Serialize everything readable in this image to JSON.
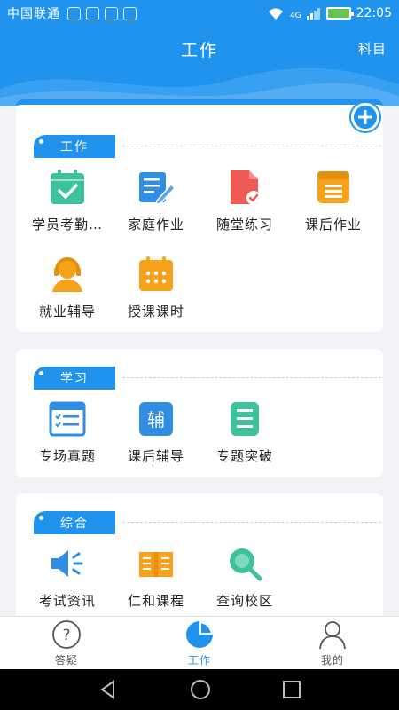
{
  "status": {
    "carrier": "中国联通",
    "network": "4G",
    "time": "22:05"
  },
  "header": {
    "title": "工作",
    "action": "科目"
  },
  "sections": [
    {
      "title": "工作",
      "items": [
        {
          "label": "学员考勤…",
          "icon": "attendance-calendar-icon",
          "color": "#3dc29b"
        },
        {
          "label": "家庭作业",
          "icon": "homework-edit-icon",
          "color": "#2f8de4"
        },
        {
          "label": "随堂练习",
          "icon": "practice-doc-icon",
          "color": "#ef5a57"
        },
        {
          "label": "课后作业",
          "icon": "after-class-list-icon",
          "color": "#f7a21b"
        },
        {
          "label": "就业辅导",
          "icon": "headset-person-icon",
          "color": "#f7a21b"
        },
        {
          "label": "授课课时",
          "icon": "class-hours-calendar-icon",
          "color": "#f7a21b"
        }
      ]
    },
    {
      "title": "学习",
      "items": [
        {
          "label": "专场真题",
          "icon": "exam-checklist-icon",
          "color": "#2f8de4"
        },
        {
          "label": "课后辅导",
          "icon": "tutor-fu-icon",
          "glyph": "辅",
          "color": "#2f8de4"
        },
        {
          "label": "专题突破",
          "icon": "topic-book-icon",
          "color": "#3dc29b"
        }
      ]
    },
    {
      "title": "综合",
      "items": [
        {
          "label": "考试资讯",
          "icon": "speaker-icon",
          "color": "#2f8de4"
        },
        {
          "label": "仁和课程",
          "icon": "open-book-icon",
          "color": "#f7a21b"
        },
        {
          "label": "查询校区",
          "icon": "search-magnifier-icon",
          "color": "#3dc29b"
        }
      ]
    }
  ],
  "tabs": [
    {
      "label": "答疑",
      "icon": "question-circle-icon"
    },
    {
      "label": "工作",
      "icon": "pie-chart-icon"
    },
    {
      "label": "我的",
      "icon": "person-icon"
    }
  ],
  "colors": {
    "accent": "#1f93ee",
    "background": "#f1f3f7"
  }
}
